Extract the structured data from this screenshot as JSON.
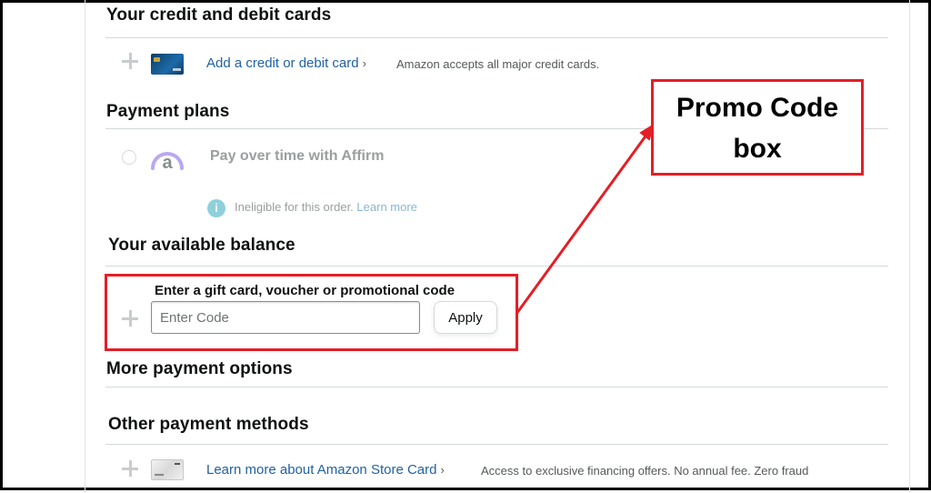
{
  "sections": {
    "cards_heading": "Your credit and debit cards",
    "payment_plans_heading": "Payment plans",
    "balance_heading": "Your available balance",
    "more_options_heading": "More payment options",
    "other_methods_heading": "Other payment methods"
  },
  "cards": {
    "add_link": "Add a credit or debit card",
    "chevron": "›",
    "accepts_note": "Amazon accepts all major credit cards."
  },
  "payment_plans": {
    "affirm_label": "Pay over time with Affirm",
    "affirm_logo_char": "a",
    "info_char": "i",
    "ineligible": "Ineligible for this order.",
    "learn_more": "Learn more"
  },
  "balance": {
    "gift_label": "Enter a gift card, voucher or promotional code",
    "code_placeholder": "Enter Code",
    "apply_label": "Apply"
  },
  "other_methods": {
    "store_card_link": "Learn more about Amazon Store Card",
    "chevron": "›",
    "store_card_note": "Access to exclusive financing offers. No annual fee. Zero fraud"
  },
  "annotation": {
    "callout_line1": "Promo Code",
    "callout_line2": "box",
    "color": "#e41e26"
  },
  "icons": [
    "plus-icon",
    "card-icon",
    "affirm-logo-icon",
    "info-icon",
    "store-card-icon",
    "arrow-icon"
  ],
  "colors": {
    "link": "#2162a1",
    "annotation_red": "#e41e26",
    "muted_text": "#565959"
  }
}
